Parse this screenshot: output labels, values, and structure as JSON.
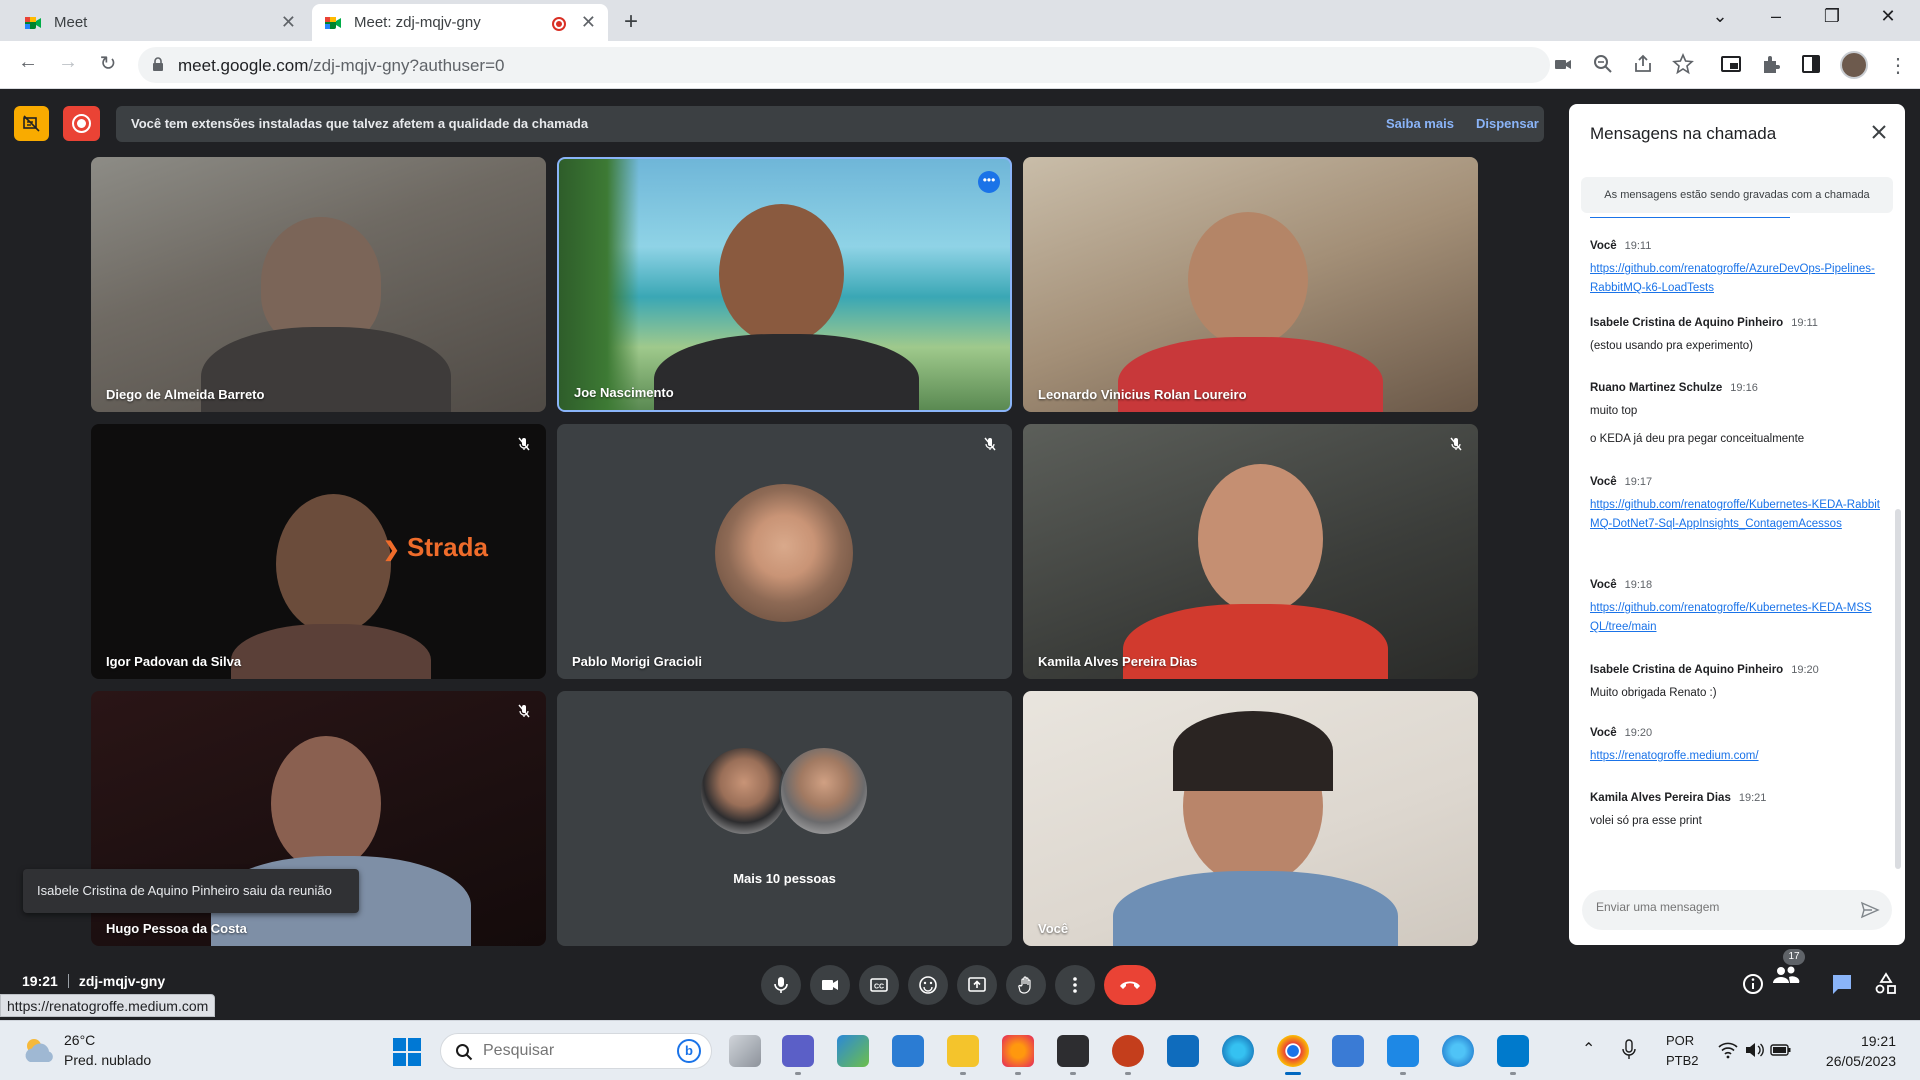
{
  "browser": {
    "tabs": [
      {
        "title": "Meet"
      },
      {
        "title": "Meet: zdj-mqjv-gny"
      }
    ],
    "url_host": "meet.google.com",
    "url_path": "/zdj-mqjv-gny?authuser=0"
  },
  "banner": {
    "text": "Você tem extensões instaladas que talvez afetem a qualidade da chamada",
    "learn_more": "Saiba mais",
    "dismiss": "Dispensar"
  },
  "participants": [
    {
      "name": "Diego de Almeida Barreto",
      "muted": false
    },
    {
      "name": "Joe Nascimento",
      "muted": false
    },
    {
      "name": "Leonardo Vinicius Rolan Loureiro",
      "muted": false
    },
    {
      "name": "Igor Padovan da Silva",
      "muted": true
    },
    {
      "name": "Pablo Morigi Gracioli",
      "muted": true
    },
    {
      "name": "Kamila Alves Pereira Dias",
      "muted": true
    },
    {
      "name": "Hugo Pessoa da Costa",
      "muted": true
    },
    {
      "name": "Mais 10 pessoas",
      "muted": false
    },
    {
      "name": "Você",
      "muted": false
    }
  ],
  "video_overlay_text": "Strada",
  "toast": "Isabele Cristina de Aquino Pinheiro saiu da reunião",
  "meeting": {
    "time": "19:21",
    "code": "zdj-mqjv-gny",
    "people_count": "17"
  },
  "status_link": "https://renatogroffe.medium.com",
  "chat": {
    "title": "Mensagens na chamada",
    "note": "As mensagens estão sendo gravadas com a chamada",
    "input_placeholder": "Enviar uma mensagem",
    "messages": [
      {
        "author": "Você",
        "time": "19:11",
        "link": "https://github.com/renatogroffe/AzureDevOps-Pipelines-RabbitMQ-k6-LoadTests"
      },
      {
        "author": "Isabele Cristina de Aquino Pinheiro",
        "time": "19:11",
        "text": "(estou usando pra experimento)"
      },
      {
        "author": "Ruano Martinez Schulze",
        "time": "19:16",
        "text": "muito top",
        "text2": "o KEDA já deu pra pegar conceitualmente"
      },
      {
        "author": "Você",
        "time": "19:17",
        "link": "https://github.com/renatogroffe/Kubernetes-KEDA-RabbitMQ-DotNet7-Sql-AppInsights_ContagemAcessos"
      },
      {
        "author": "Você",
        "time": "19:18",
        "link": "https://github.com/renatogroffe/Kubernetes-KEDA-MSSQL/tree/main"
      },
      {
        "author": "Isabele Cristina de Aquino Pinheiro",
        "time": "19:20",
        "text": "Muito obrigada Renato :)"
      },
      {
        "author": "Você",
        "time": "19:20",
        "link": "https://renatogroffe.medium.com/"
      },
      {
        "author": "Kamila Alves Pereira Dias",
        "time": "19:21",
        "text": "volei só pra esse print"
      }
    ]
  },
  "taskbar": {
    "weather_temp": "26°C",
    "weather_desc": "Pred. nublado",
    "search_placeholder": "Pesquisar",
    "lang1": "POR",
    "lang2": "PTB2",
    "time": "19:21",
    "date": "26/05/2023"
  },
  "colors": {
    "accent": "#1a73e8",
    "hangup": "#ea4335",
    "meet_bg": "#202124"
  }
}
